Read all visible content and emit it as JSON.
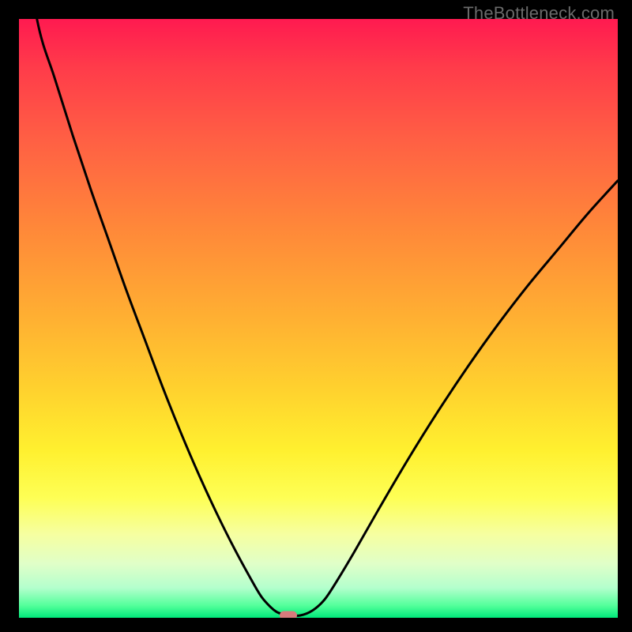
{
  "watermark": "TheBottleneck.com",
  "chart_data": {
    "type": "line",
    "title": "",
    "xlabel": "",
    "ylabel": "",
    "xlim": [
      0,
      100
    ],
    "ylim": [
      0,
      100
    ],
    "x": [
      0,
      3,
      6,
      9,
      12,
      15,
      18,
      21,
      24,
      27,
      30,
      33,
      36,
      39,
      40.5,
      42,
      43,
      44,
      45,
      47,
      49,
      51,
      53,
      56,
      60,
      65,
      70,
      75,
      80,
      85,
      90,
      95,
      100
    ],
    "values": [
      120,
      100,
      90,
      80.5,
      71.5,
      63,
      54.5,
      46.5,
      38.5,
      31,
      24,
      17.5,
      11.5,
      6,
      3.5,
      1.8,
      1.0,
      0.6,
      0.4,
      0.4,
      1.2,
      3.0,
      6.0,
      11,
      18,
      26.5,
      34.5,
      42,
      49,
      55.5,
      61.5,
      67.5,
      73
    ],
    "marker_x": 45,
    "marker_y": 0.4,
    "gradient_colors": {
      "top": "#ff1a50",
      "mid": "#ffd22e",
      "bottom": "#00e87a"
    }
  }
}
